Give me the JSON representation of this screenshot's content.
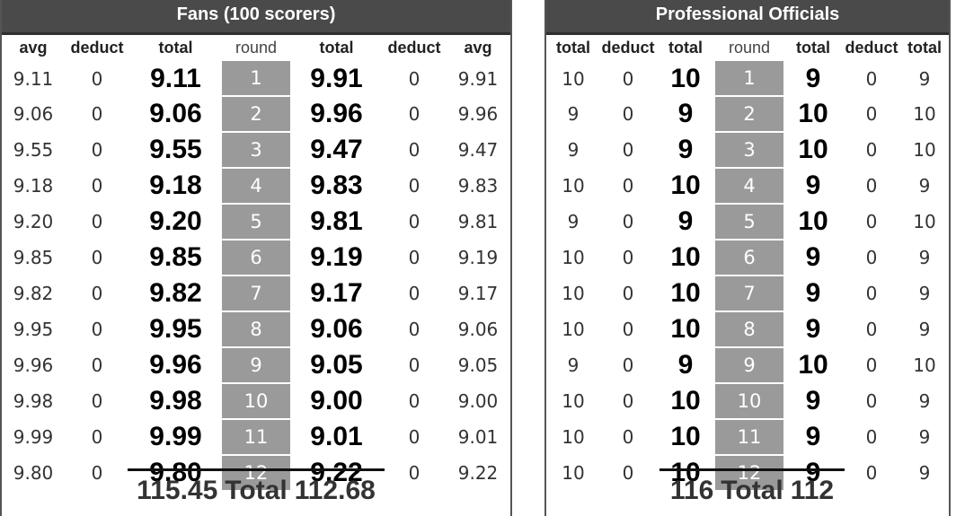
{
  "fans": {
    "title": "Fans (100 scorers)",
    "headers": [
      "avg",
      "deduct",
      "total",
      "round",
      "total",
      "deduct",
      "avg"
    ],
    "rows": [
      {
        "avg_a": "9.11",
        "deduct_a": "0",
        "total_a": "9.11",
        "round": "1",
        "total_b": "9.91",
        "deduct_b": "0",
        "avg_b": "9.91"
      },
      {
        "avg_a": "9.06",
        "deduct_a": "0",
        "total_a": "9.06",
        "round": "2",
        "total_b": "9.96",
        "deduct_b": "0",
        "avg_b": "9.96"
      },
      {
        "avg_a": "9.55",
        "deduct_a": "0",
        "total_a": "9.55",
        "round": "3",
        "total_b": "9.47",
        "deduct_b": "0",
        "avg_b": "9.47"
      },
      {
        "avg_a": "9.18",
        "deduct_a": "0",
        "total_a": "9.18",
        "round": "4",
        "total_b": "9.83",
        "deduct_b": "0",
        "avg_b": "9.83"
      },
      {
        "avg_a": "9.20",
        "deduct_a": "0",
        "total_a": "9.20",
        "round": "5",
        "total_b": "9.81",
        "deduct_b": "0",
        "avg_b": "9.81"
      },
      {
        "avg_a": "9.85",
        "deduct_a": "0",
        "total_a": "9.85",
        "round": "6",
        "total_b": "9.19",
        "deduct_b": "0",
        "avg_b": "9.19"
      },
      {
        "avg_a": "9.82",
        "deduct_a": "0",
        "total_a": "9.82",
        "round": "7",
        "total_b": "9.17",
        "deduct_b": "0",
        "avg_b": "9.17"
      },
      {
        "avg_a": "9.95",
        "deduct_a": "0",
        "total_a": "9.95",
        "round": "8",
        "total_b": "9.06",
        "deduct_b": "0",
        "avg_b": "9.06"
      },
      {
        "avg_a": "9.96",
        "deduct_a": "0",
        "total_a": "9.96",
        "round": "9",
        "total_b": "9.05",
        "deduct_b": "0",
        "avg_b": "9.05"
      },
      {
        "avg_a": "9.98",
        "deduct_a": "0",
        "total_a": "9.98",
        "round": "10",
        "total_b": "9.00",
        "deduct_b": "0",
        "avg_b": "9.00"
      },
      {
        "avg_a": "9.99",
        "deduct_a": "0",
        "total_a": "9.99",
        "round": "11",
        "total_b": "9.01",
        "deduct_b": "0",
        "avg_b": "9.01"
      },
      {
        "avg_a": "9.80",
        "deduct_a": "0",
        "total_a": "9.80",
        "round": "12",
        "total_b": "9.22",
        "deduct_b": "0",
        "avg_b": "9.22"
      }
    ],
    "grand_total_a": "115.45",
    "total_label": "Total",
    "grand_total_b": "112.68"
  },
  "officials": {
    "title": "Professional Officials",
    "headers": [
      "total",
      "deduct",
      "total",
      "round",
      "total",
      "deduct",
      "total"
    ],
    "rows": [
      {
        "score_a": "10",
        "deduct_a": "0",
        "total_a": "10",
        "round": "1",
        "total_b": "9",
        "deduct_b": "0",
        "score_b": "9"
      },
      {
        "score_a": "9",
        "deduct_a": "0",
        "total_a": "9",
        "round": "2",
        "total_b": "10",
        "deduct_b": "0",
        "score_b": "10"
      },
      {
        "score_a": "9",
        "deduct_a": "0",
        "total_a": "9",
        "round": "3",
        "total_b": "10",
        "deduct_b": "0",
        "score_b": "10"
      },
      {
        "score_a": "10",
        "deduct_a": "0",
        "total_a": "10",
        "round": "4",
        "total_b": "9",
        "deduct_b": "0",
        "score_b": "9"
      },
      {
        "score_a": "9",
        "deduct_a": "0",
        "total_a": "9",
        "round": "5",
        "total_b": "10",
        "deduct_b": "0",
        "score_b": "10"
      },
      {
        "score_a": "10",
        "deduct_a": "0",
        "total_a": "10",
        "round": "6",
        "total_b": "9",
        "deduct_b": "0",
        "score_b": "9"
      },
      {
        "score_a": "10",
        "deduct_a": "0",
        "total_a": "10",
        "round": "7",
        "total_b": "9",
        "deduct_b": "0",
        "score_b": "9"
      },
      {
        "score_a": "10",
        "deduct_a": "0",
        "total_a": "10",
        "round": "8",
        "total_b": "9",
        "deduct_b": "0",
        "score_b": "9"
      },
      {
        "score_a": "9",
        "deduct_a": "0",
        "total_a": "9",
        "round": "9",
        "total_b": "10",
        "deduct_b": "0",
        "score_b": "10"
      },
      {
        "score_a": "10",
        "deduct_a": "0",
        "total_a": "10",
        "round": "10",
        "total_b": "9",
        "deduct_b": "0",
        "score_b": "9"
      },
      {
        "score_a": "10",
        "deduct_a": "0",
        "total_a": "10",
        "round": "11",
        "total_b": "9",
        "deduct_b": "0",
        "score_b": "9"
      },
      {
        "score_a": "10",
        "deduct_a": "0",
        "total_a": "10",
        "round": "12",
        "total_b": "9",
        "deduct_b": "0",
        "score_b": "9"
      }
    ],
    "grand_total_a": "116",
    "total_label": "Total",
    "grand_total_b": "112"
  }
}
